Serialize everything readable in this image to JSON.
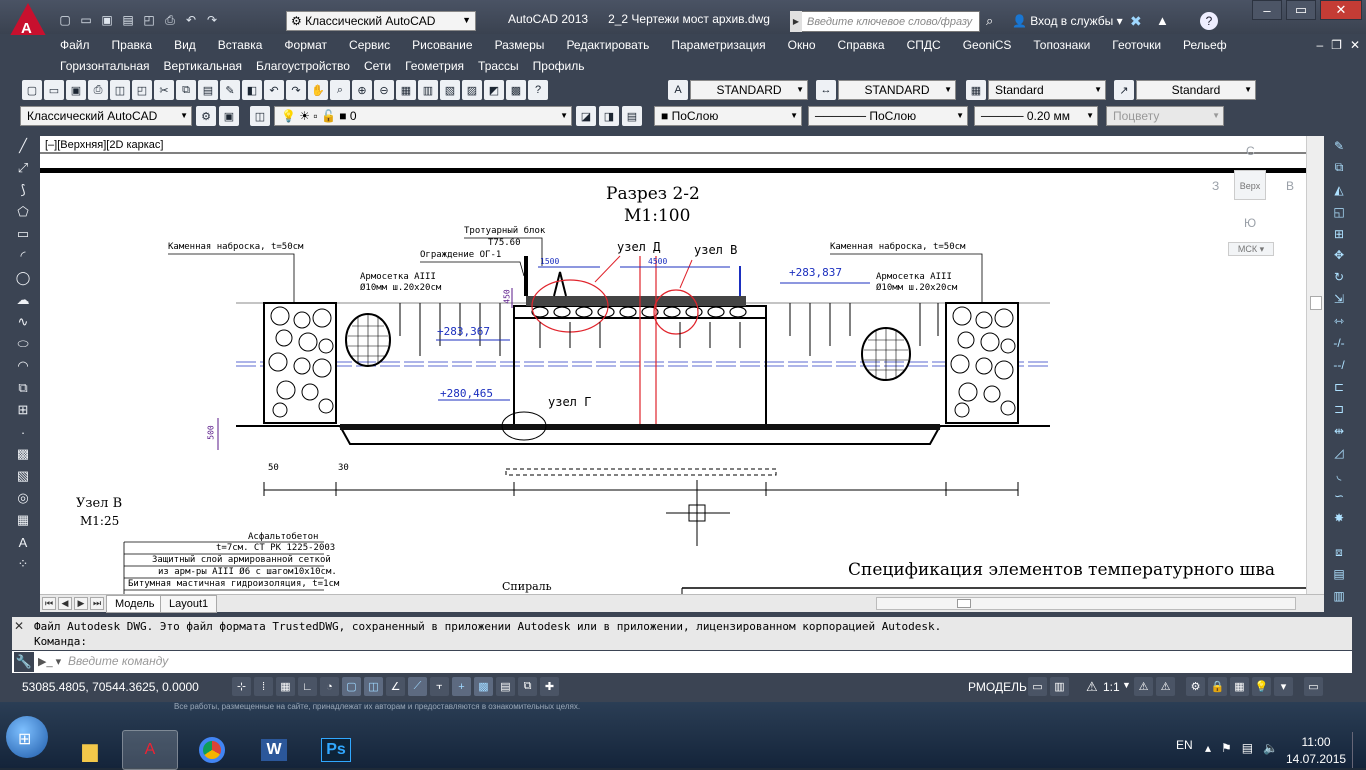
{
  "title": {
    "app": "AutoCAD 2013",
    "document": "2_2 Чертежи мост архив.dwg",
    "workspace": "Классический AutoCAD",
    "search_placeholder": "Введите ключевое слово/фразу",
    "login": "Вход в службы"
  },
  "menu": {
    "row1": [
      "Файл",
      "Правка",
      "Вид",
      "Вставка",
      "Формат",
      "Сервис",
      "Рисование",
      "Размеры",
      "Редактировать",
      "Параметризация",
      "Окно",
      "Справка",
      "СПДС",
      "GeoniCS",
      "Топознаки",
      "Геоточки",
      "Рельеф"
    ],
    "row2": [
      "Горизонтальная",
      "Вертикальная",
      "Благоустройство",
      "Сети",
      "Геометрия",
      "Трассы",
      "Профиль"
    ]
  },
  "styles": {
    "text_style": "STANDARD",
    "dim_style": "STANDARD",
    "table_style": "Standard",
    "multileader_style": "Standard"
  },
  "layers": {
    "workspace": "Классический AutoCAD",
    "current_layer": "0",
    "color": "ПоСлою",
    "linetype": "ПоСлою",
    "lineweight": "0.20 мм",
    "plotstyle": "Поцвету"
  },
  "viewport": {
    "label": "[–][Верхняя][2D каркас]",
    "viewcube": {
      "top": "С",
      "west": "З",
      "east": "В",
      "south": "Ю",
      "face": "Верх",
      "ucs": "МСК"
    }
  },
  "drawing": {
    "title": "Разрез 2-2",
    "scale": "М1:100",
    "labels": {
      "rock_left": "Каменная наброска, t=50см",
      "rock_right": "Каменная наброска, t=50см",
      "mesh_left_1": "Армосетка AIII",
      "mesh_left_2": "Ø10мм ш.20х20см",
      "mesh_right_1": "Армосетка AIII",
      "mesh_right_2": "Ø10мм ш.20х20см",
      "sidewalk_1": "Тротуарный блок",
      "sidewalk_2": "Т75.60",
      "barrier": "Ограждение ОГ-1",
      "node_d": "узел Д",
      "node_v": "узел В",
      "node_g": "узел Г",
      "elev_1": "+283,837",
      "elev_2": "+283,367",
      "elev_3": "+280,465",
      "dim_1500": "1500",
      "dim_4500": "4500",
      "dim_450": "450",
      "dim_500": "500",
      "dim_50": "50",
      "dim_30": "30",
      "node_title": "Узел В",
      "node_scale": "М1:25",
      "spec_title": "Спецификация элементов температурного шва",
      "spiral": "Спираль"
    },
    "layers_table": [
      "Асфальтобетон",
      "t=7см. СТ РК 1225-2003",
      "Защитный слой армированной сеткой",
      "из арм-ры AIII Ø6 с шагом10х10см.",
      "Битумная мастичная гидроизоляция, t=1см"
    ]
  },
  "layout_tabs": [
    "Модель",
    "Layout1"
  ],
  "command": {
    "history_1": "Файл Autodesk DWG. Это файл формата TrustedDWG, сохраненный в приложении Autodesk или в приложении, лицензированном корпорацией Autodesk.",
    "history_2": "Команда:",
    "placeholder": "Введите команду"
  },
  "status": {
    "coordinates": "53085.4805, 70544.3625, 0.0000",
    "model": "РМОДЕЛЬ",
    "scale": "1:1"
  },
  "taskbar": {
    "language": "EN",
    "time": "11:00",
    "date": "14.07.2015",
    "wallpaper_note": "Все работы, размещенные на сайте, принадлежат их авторам и предоставляются в ознакомительных целях."
  },
  "colors": {
    "chrome": "#3b4453",
    "canvas": "#ffffff",
    "accent_red": "#c8102e",
    "dim_blue": "#1b2fbf"
  }
}
